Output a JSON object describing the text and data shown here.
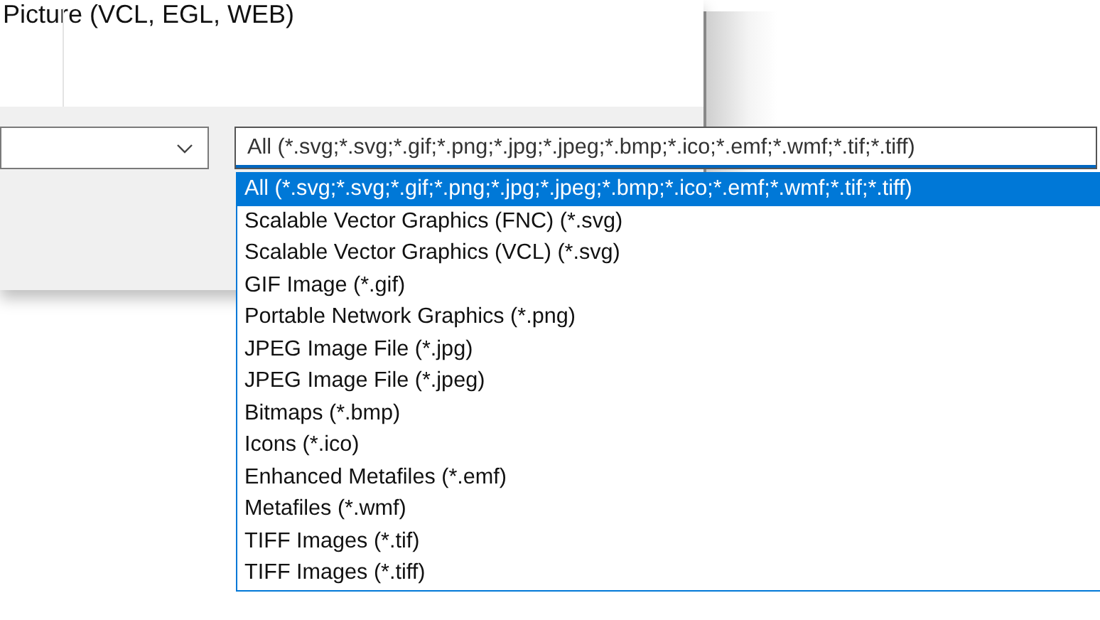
{
  "heading": "Picture (VCL, EGL, WEB)",
  "left_combo": {
    "expanded": false
  },
  "file_type_combo": {
    "value": "All (*.svg;*.svg;*.gif;*.png;*.jpg;*.jpeg;*.bmp;*.ico;*.emf;*.wmf;*.tif;*.tiff)",
    "expanded": true
  },
  "file_types": [
    {
      "label": "All (*.svg;*.svg;*.gif;*.png;*.jpg;*.jpeg;*.bmp;*.ico;*.emf;*.wmf;*.tif;*.tiff)",
      "selected": true
    },
    {
      "label": "Scalable Vector Graphics (FNC) (*.svg)",
      "selected": false
    },
    {
      "label": "Scalable Vector Graphics (VCL) (*.svg)",
      "selected": false
    },
    {
      "label": "GIF Image (*.gif)",
      "selected": false
    },
    {
      "label": "Portable Network Graphics (*.png)",
      "selected": false
    },
    {
      "label": "JPEG Image File (*.jpg)",
      "selected": false
    },
    {
      "label": "JPEG Image File (*.jpeg)",
      "selected": false
    },
    {
      "label": "Bitmaps (*.bmp)",
      "selected": false
    },
    {
      "label": "Icons (*.ico)",
      "selected": false
    },
    {
      "label": "Enhanced Metafiles (*.emf)",
      "selected": false
    },
    {
      "label": "Metafiles (*.wmf)",
      "selected": false
    },
    {
      "label": "TIFF Images (*.tif)",
      "selected": false
    },
    {
      "label": "TIFF Images (*.tiff)",
      "selected": false
    }
  ]
}
